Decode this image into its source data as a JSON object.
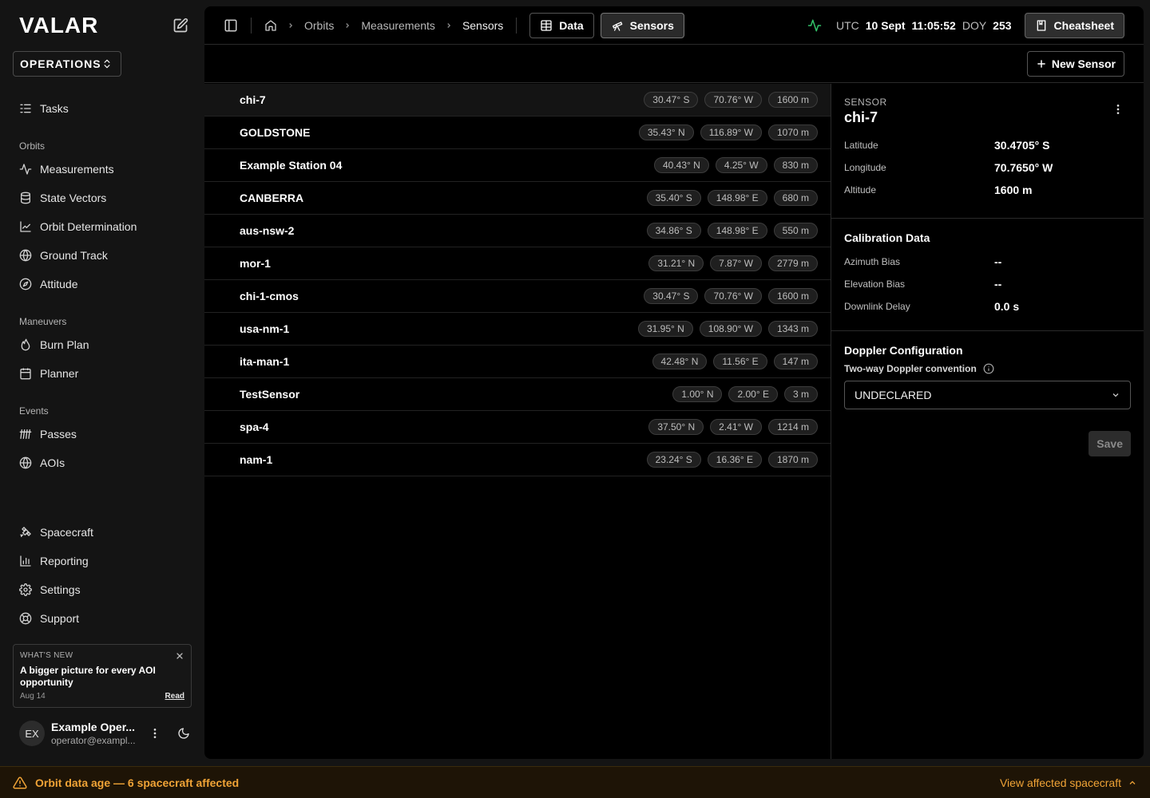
{
  "app": {
    "logo": "VALAR",
    "org": "OPERATIONS"
  },
  "sidebar": {
    "top_items": [
      {
        "label": "Tasks",
        "icon": "tasks-icon"
      }
    ],
    "groups": [
      {
        "title": "Orbits",
        "items": [
          {
            "label": "Measurements",
            "icon": "activity-icon"
          },
          {
            "label": "State Vectors",
            "icon": "database-icon"
          },
          {
            "label": "Orbit Determination",
            "icon": "line-chart-icon"
          },
          {
            "label": "Ground Track",
            "icon": "globe-icon"
          },
          {
            "label": "Attitude",
            "icon": "compass-icon"
          }
        ]
      },
      {
        "title": "Maneuvers",
        "items": [
          {
            "label": "Burn Plan",
            "icon": "flame-icon"
          },
          {
            "label": "Planner",
            "icon": "calendar-icon"
          }
        ]
      },
      {
        "title": "Events",
        "items": [
          {
            "label": "Passes",
            "icon": "passes-icon"
          },
          {
            "label": "AOIs",
            "icon": "globe-icon"
          }
        ]
      }
    ],
    "bottom_items": [
      {
        "label": "Spacecraft",
        "icon": "satellite-icon"
      },
      {
        "label": "Reporting",
        "icon": "bar-chart-icon"
      },
      {
        "label": "Settings",
        "icon": "gear-icon"
      },
      {
        "label": "Support",
        "icon": "lifebuoy-icon"
      }
    ],
    "news": {
      "label": "WHAT'S NEW",
      "title": "A bigger picture for every AOI opportunity",
      "date": "Aug 14",
      "read": "Read"
    },
    "user": {
      "initials": "EX",
      "name": "Example Oper...",
      "email": "operator@exampl..."
    }
  },
  "header": {
    "breadcrumbs": [
      "Orbits",
      "Measurements",
      "Sensors"
    ],
    "tabs": [
      {
        "label": "Data",
        "active": false
      },
      {
        "label": "Sensors",
        "active": true
      }
    ],
    "clock": {
      "tz": "UTC",
      "date": "10 Sept",
      "time": "11:05:52",
      "doy_label": "DOY",
      "doy": "253"
    },
    "cheatsheet": "Cheatsheet",
    "status_color": "#33c46a"
  },
  "toolbar": {
    "new_sensor": "New Sensor"
  },
  "sensors": [
    {
      "name": "chi-7",
      "lat": "30.47° S",
      "lon": "70.76° W",
      "alt": "1600 m",
      "selected": true
    },
    {
      "name": "GOLDSTONE",
      "lat": "35.43° N",
      "lon": "116.89° W",
      "alt": "1070 m"
    },
    {
      "name": "Example Station 04",
      "lat": "40.43° N",
      "lon": "4.25° W",
      "alt": "830 m"
    },
    {
      "name": "CANBERRA",
      "lat": "35.40° S",
      "lon": "148.98° E",
      "alt": "680 m"
    },
    {
      "name": "aus-nsw-2",
      "lat": "34.86° S",
      "lon": "148.98° E",
      "alt": "550 m"
    },
    {
      "name": "mor-1",
      "lat": "31.21° N",
      "lon": "7.87° W",
      "alt": "2779 m"
    },
    {
      "name": "chi-1-cmos",
      "lat": "30.47° S",
      "lon": "70.76° W",
      "alt": "1600 m"
    },
    {
      "name": "usa-nm-1",
      "lat": "31.95° N",
      "lon": "108.90° W",
      "alt": "1343 m"
    },
    {
      "name": "ita-man-1",
      "lat": "42.48° N",
      "lon": "11.56° E",
      "alt": "147 m"
    },
    {
      "name": "TestSensor",
      "lat": "1.00° N",
      "lon": "2.00° E",
      "alt": "3 m"
    },
    {
      "name": "spa-4",
      "lat": "37.50° N",
      "lon": "2.41° W",
      "alt": "1214 m"
    },
    {
      "name": "nam-1",
      "lat": "23.24° S",
      "lon": "16.36° E",
      "alt": "1870 m"
    }
  ],
  "detail": {
    "label": "SENSOR",
    "name": "chi-7",
    "fields": [
      {
        "k": "Latitude",
        "v": "30.4705° S"
      },
      {
        "k": "Longitude",
        "v": "70.7650° W"
      },
      {
        "k": "Altitude",
        "v": "1600 m"
      }
    ],
    "calibration_title": "Calibration Data",
    "calibration": [
      {
        "k": "Azimuth Bias",
        "v": "--"
      },
      {
        "k": "Elevation Bias",
        "v": "--"
      },
      {
        "k": "Downlink Delay",
        "v": "0.0 s"
      }
    ],
    "doppler_title": "Doppler Configuration",
    "doppler_label": "Two-way Doppler convention",
    "doppler_value": "UNDECLARED",
    "save": "Save"
  },
  "banner": {
    "message": "Orbit data age — 6 spacecraft affected",
    "action": "View affected spacecraft",
    "color": "#f0a336"
  }
}
